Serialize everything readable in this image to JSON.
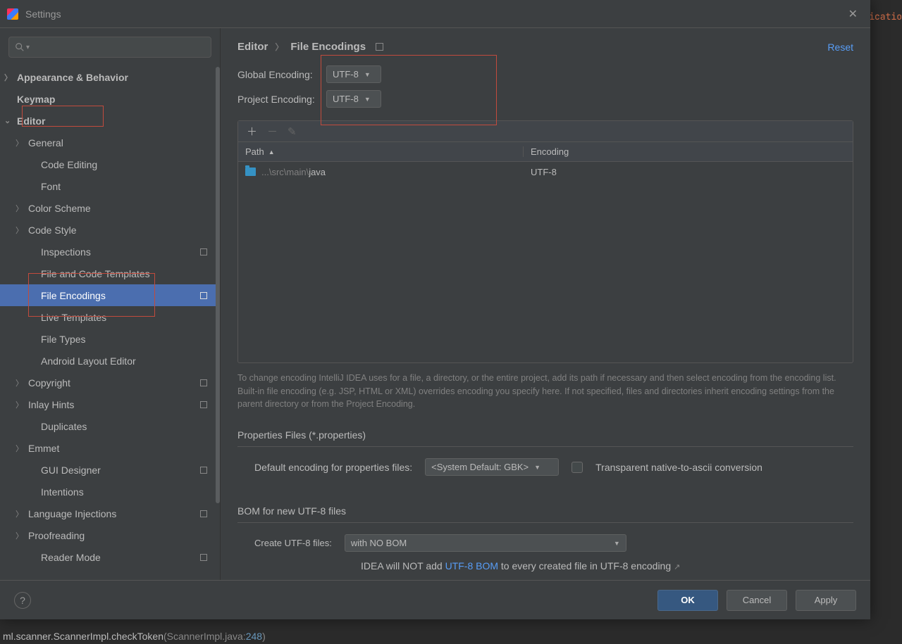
{
  "bg_text": "plicatio",
  "window": {
    "title": "Settings"
  },
  "sidebar": {
    "items": [
      {
        "label": "Appearance & Behavior"
      },
      {
        "label": "Keymap"
      },
      {
        "label": "Editor"
      },
      {
        "label": "General"
      },
      {
        "label": "Code Editing"
      },
      {
        "label": "Font"
      },
      {
        "label": "Color Scheme"
      },
      {
        "label": "Code Style"
      },
      {
        "label": "Inspections"
      },
      {
        "label": "File and Code Templates"
      },
      {
        "label": "File Encodings"
      },
      {
        "label": "Live Templates"
      },
      {
        "label": "File Types"
      },
      {
        "label": "Android Layout Editor"
      },
      {
        "label": "Copyright"
      },
      {
        "label": "Inlay Hints"
      },
      {
        "label": "Duplicates"
      },
      {
        "label": "Emmet"
      },
      {
        "label": "GUI Designer"
      },
      {
        "label": "Intentions"
      },
      {
        "label": "Language Injections"
      },
      {
        "label": "Proofreading"
      },
      {
        "label": "Reader Mode"
      }
    ]
  },
  "breadcrumb": {
    "root": "Editor",
    "leaf": "File Encodings"
  },
  "reset": "Reset",
  "form": {
    "global_label": "Global Encoding:",
    "global_value": "UTF-8",
    "project_label": "Project Encoding:",
    "project_value": "UTF-8"
  },
  "table": {
    "header_path": "Path",
    "header_encoding": "Encoding",
    "rows": [
      {
        "prefix": "...\\src\\main\\",
        "name": "java",
        "encoding": "UTF-8"
      }
    ]
  },
  "hint": "To change encoding IntelliJ IDEA uses for a file, a directory, or the entire project, add its path if necessary and then select encoding from the encoding list. Built-in file encoding (e.g. JSP, HTML or XML) overrides encoding you specify here. If not specified, files and directories inherit encoding settings from the parent directory or from the Project Encoding.",
  "properties": {
    "title": "Properties Files (*.properties)",
    "default_label": "Default encoding for properties files:",
    "default_value": "<System Default: GBK>",
    "transparent": "Transparent native-to-ascii conversion"
  },
  "bom": {
    "title": "BOM for new UTF-8 files",
    "create_label": "Create UTF-8 files:",
    "create_value": "with NO BOM",
    "hint_prefix": "IDEA will NOT add ",
    "hint_link": "UTF-8 BOM",
    "hint_suffix": " to every created file in UTF-8 encoding"
  },
  "footer": {
    "ok": "OK",
    "cancel": "Cancel",
    "apply": "Apply"
  },
  "console": {
    "prefix": "ml.scanner.ScannerImpl.checkToken",
    "file": "ScannerImpl.java",
    "line": "248"
  }
}
